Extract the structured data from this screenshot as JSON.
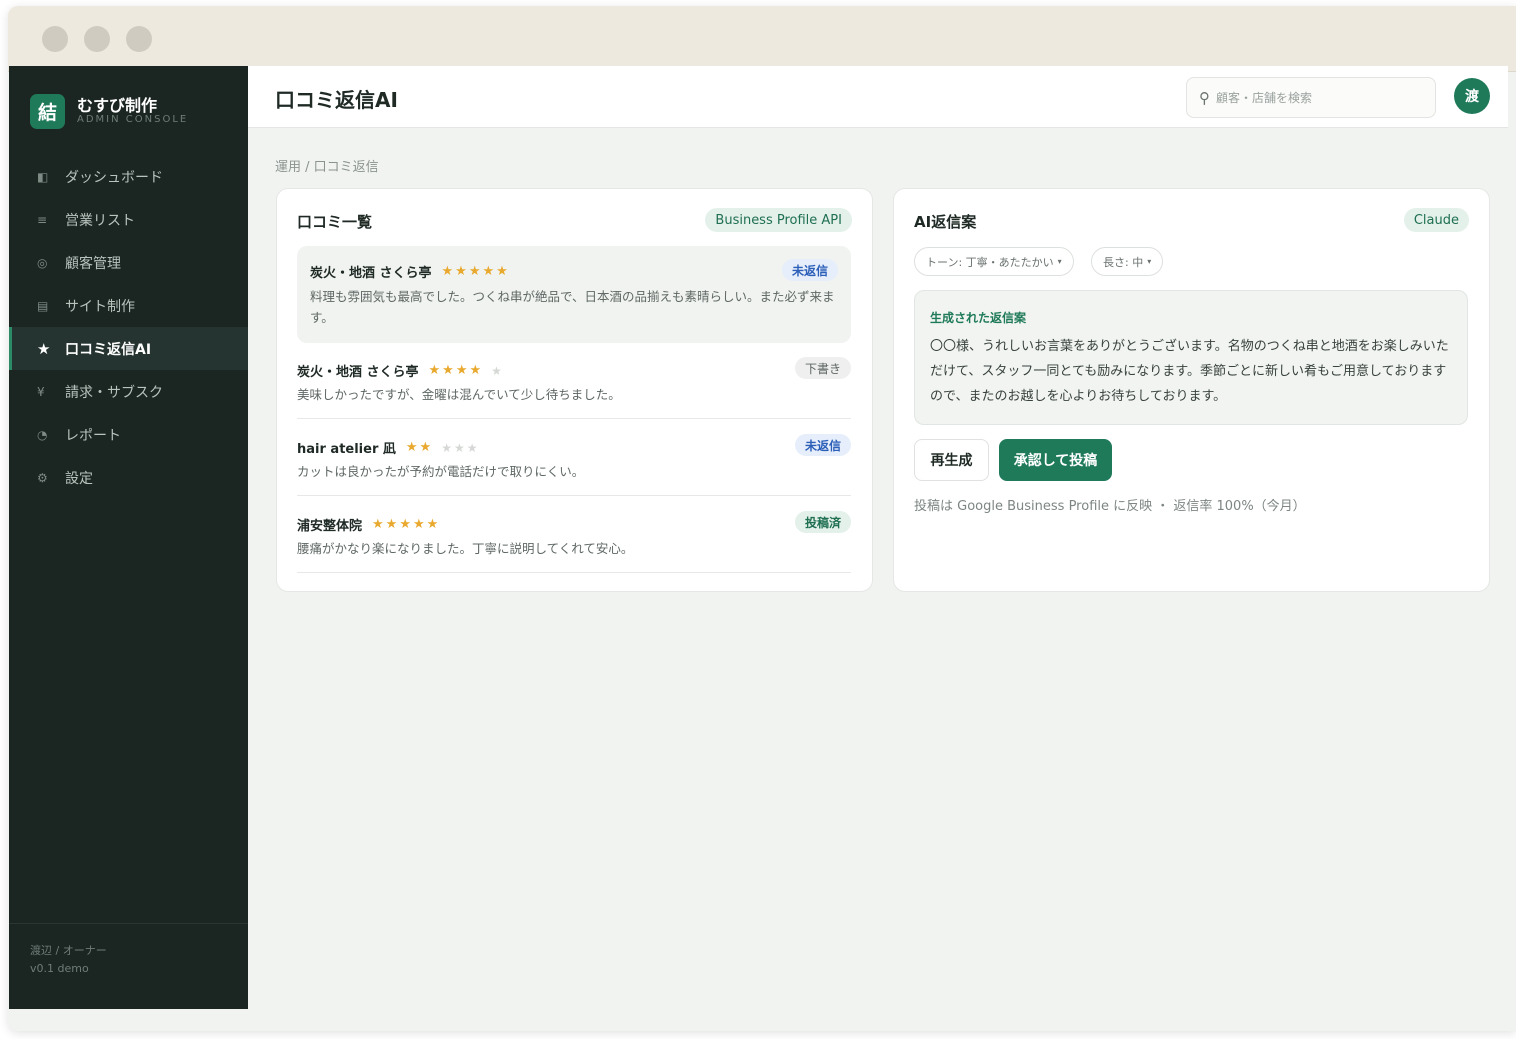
{
  "brand": {
    "logo": "結",
    "name": "むすび制作",
    "subtitle": "ADMIN CONSOLE"
  },
  "sidebar": {
    "items": [
      {
        "icon": "◧",
        "icon_name": "dashboard-icon",
        "label": "ダッシュボード",
        "active": false
      },
      {
        "icon": "≡",
        "icon_name": "list-icon",
        "label": "営業リスト",
        "active": false
      },
      {
        "icon": "◎",
        "icon_name": "customer-icon",
        "label": "顧客管理",
        "active": false
      },
      {
        "icon": "▤",
        "icon_name": "site-icon",
        "label": "サイト制作",
        "active": false
      },
      {
        "icon": "★",
        "icon_name": "star-icon",
        "label": "口コミ返信AI",
        "active": true
      },
      {
        "icon": "¥",
        "icon_name": "yen-icon",
        "label": "請求・サブスク",
        "active": false
      },
      {
        "icon": "◔",
        "icon_name": "report-icon",
        "label": "レポート",
        "active": false
      },
      {
        "icon": "⚙",
        "icon_name": "gear-icon",
        "label": "設定",
        "active": false
      }
    ],
    "footer_user": "渡辺 / オーナー",
    "footer_version": "v0.1 demo"
  },
  "header": {
    "title": "口コミ返信AI",
    "search_placeholder": "顧客・店舗を検索",
    "avatar": "渡"
  },
  "breadcrumb": "運用 / 口コミ返信",
  "reviews_panel": {
    "title": "口コミ一覧",
    "source_badge": "Business Profile API",
    "reviews": [
      {
        "shop": "炭火・地酒 さくら亭",
        "stars": "★★★★★",
        "empty_stars": "",
        "rating": 5,
        "status": "未返信",
        "text": "料理も雰囲気も最高でした。つくね串が絶品で、日本酒の品揃えも素晴らしい。また必ず来ます。"
      },
      {
        "shop": "炭火・地酒 さくら亭",
        "stars": "★★★★",
        "empty_stars": "★",
        "rating": 4,
        "status": "下書き",
        "text": "美味しかったですが、金曜は混んでいて少し待ちました。"
      },
      {
        "shop": "hair atelier 凪",
        "stars": "★★",
        "empty_stars": "★★★",
        "rating": 2,
        "status": "未返信",
        "text": "カットは良かったが予約が電話だけで取りにくい。"
      },
      {
        "shop": "浦安整体院",
        "stars": "★★★★★",
        "empty_stars": "",
        "rating": 5,
        "status": "投稿済",
        "text": "腰痛がかなり楽になりました。丁寧に説明してくれて安心。"
      }
    ]
  },
  "reply_panel": {
    "title": "AI返信案",
    "model_badge": "Claude",
    "tone_chip": "トーン: 丁寧・あたたかい",
    "length_chip": "長さ: 中",
    "caret": "▾",
    "generated_label": "生成された返信案",
    "generated_text": "〇〇様、うれしいお言葉をありがとうございます。名物のつくね串と地酒をお楽しみいただけて、スタッフ一同とても励みになります。季節ごとに新しい肴もご用意しておりますので、またのお越しを心よりお待ちしております。",
    "regenerate_label": "再生成",
    "approve_label": "承認して投稿",
    "footnote": "投稿は Google Business Profile に反映 ・ 返信率 100%（今月）"
  },
  "colors": {
    "accent": "#1f7a5a",
    "sidebar_bg": "#1b2521",
    "star": "#e8a92e",
    "unreplied": "#2c5fb8"
  }
}
